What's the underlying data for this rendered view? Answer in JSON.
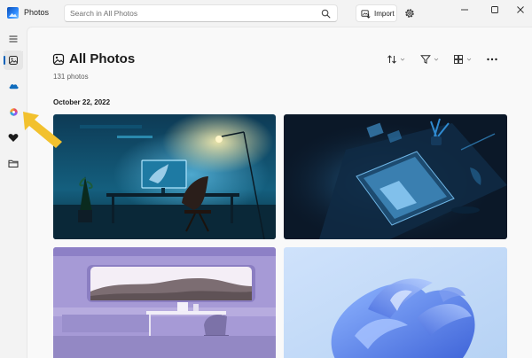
{
  "app": {
    "title": "Photos",
    "icon": "photos-app-icon"
  },
  "search": {
    "placeholder": "Search in All Photos",
    "value": "",
    "icon": "search-icon"
  },
  "toolbar": {
    "import_label": "Import",
    "import_icon": "import-icon",
    "settings_icon": "gear-icon"
  },
  "window_controls": [
    "minimize-icon",
    "maximize-icon",
    "close-icon"
  ],
  "sidebar": {
    "items": [
      {
        "name": "menu",
        "icon": "hamburger-icon",
        "active": false
      },
      {
        "name": "all-photos",
        "icon": "photos-icon",
        "active": true
      },
      {
        "name": "onedrive",
        "icon": "cloud-icon",
        "active": false,
        "color": "#0f6cbd"
      },
      {
        "name": "icloud",
        "icon": "icloud-icon",
        "active": false
      },
      {
        "name": "favorites",
        "icon": "heart-icon",
        "active": false
      },
      {
        "name": "folders",
        "icon": "folder-icon",
        "active": false
      }
    ]
  },
  "page": {
    "title": "All Photos",
    "subtitle": "131 photos",
    "title_icon": "photos-icon"
  },
  "view_toolbar": {
    "sort_icon": "sort-icon",
    "filter_icon": "filter-icon",
    "view_icon": "layout-grid-icon",
    "more_icon": "more-icon"
  },
  "gallery": {
    "date_header": "October 22, 2022",
    "photos": [
      {
        "name": "photo-desk-setup-blue"
      },
      {
        "name": "photo-tablet-dark-desk"
      },
      {
        "name": "photo-lavender-room"
      },
      {
        "name": "photo-blue-bloom"
      }
    ]
  },
  "colors": {
    "accent": "#005fb8",
    "annotation_arrow": "#f2c12e"
  }
}
